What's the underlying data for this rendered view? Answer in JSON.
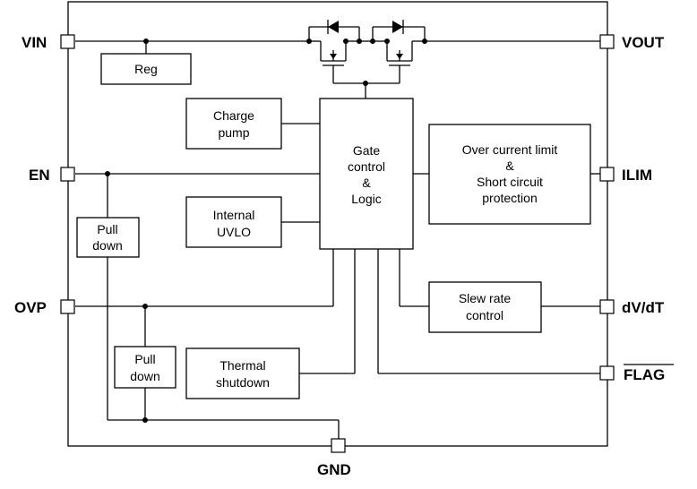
{
  "diagram": {
    "type": "block-diagram",
    "pins": {
      "vin": "VIN",
      "vout": "VOUT",
      "en": "EN",
      "ilim": "ILIM",
      "ovp": "OVP",
      "dvdt": "dV/dT",
      "flag": "FLAG",
      "gnd": "GND"
    },
    "blocks": {
      "reg": [
        "Reg"
      ],
      "charge_pump": [
        "Charge",
        "pump"
      ],
      "gate_control": [
        "Gate",
        "control",
        "&",
        "Logic"
      ],
      "internal_uvlo": [
        "Internal",
        "UVLO"
      ],
      "over_current": [
        "Over current limit",
        "&",
        "Short circuit",
        "protection"
      ],
      "pull_down_en": [
        "Pull",
        "down"
      ],
      "pull_down_ovp": [
        "Pull",
        "down"
      ],
      "slew_rate": [
        "Slew rate",
        "control"
      ],
      "thermal": [
        "Thermal",
        "shutdown"
      ]
    }
  }
}
